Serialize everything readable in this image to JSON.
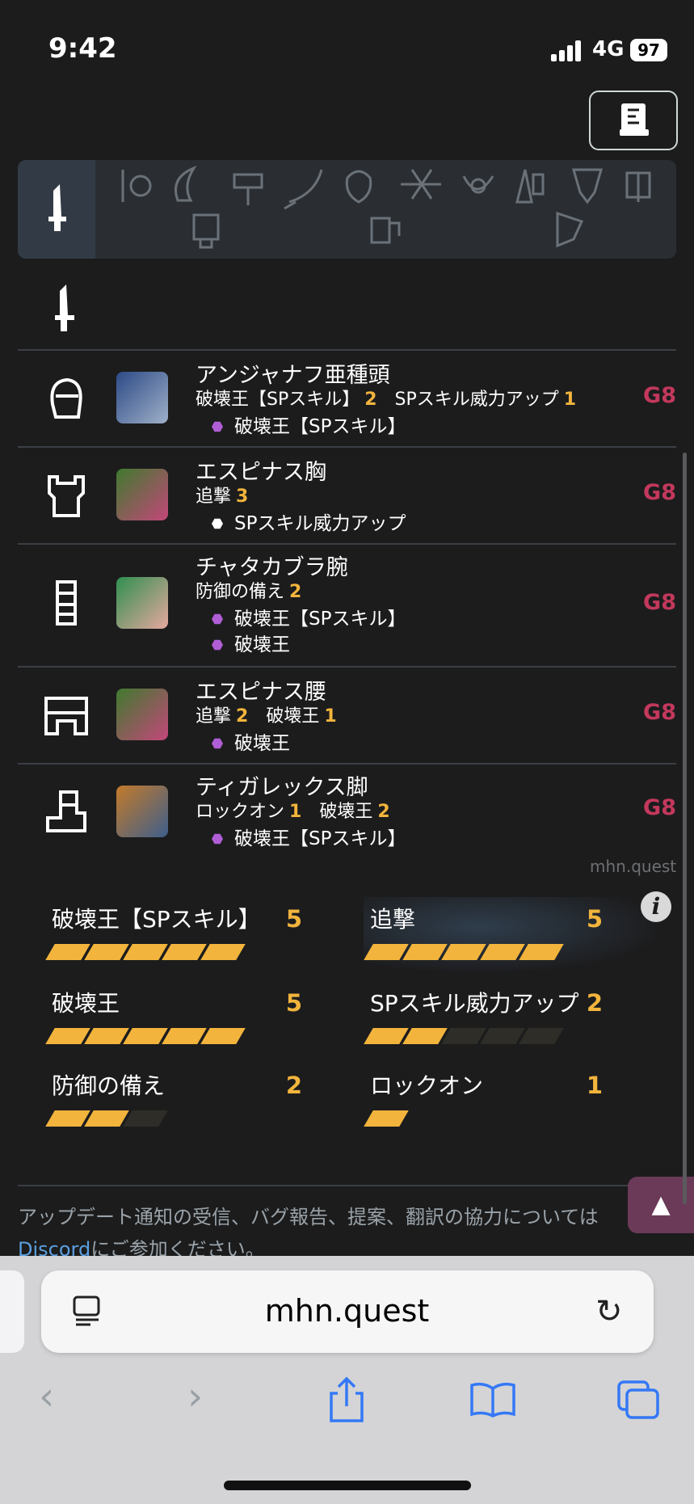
{
  "status": {
    "time": "9:42",
    "network": "4G",
    "battery": "97"
  },
  "current_weapon_icon": "great-sword-icon",
  "armor": [
    {
      "slot": "head",
      "icon": "helmet-icon",
      "name": "アンジャナフ亜種頭",
      "skills": [
        {
          "name": "破壊王【SPスキル】",
          "level": "2"
        },
        {
          "name": "SPスキル威力アップ",
          "level": "1"
        }
      ],
      "decos": [
        {
          "name": "破壊王【SPスキル】",
          "color": "#b05ed6"
        }
      ],
      "grade": "G8"
    },
    {
      "slot": "chest",
      "icon": "chest-icon",
      "name": "エスピナス胸",
      "skills": [
        {
          "name": "追撃",
          "level": "3"
        }
      ],
      "decos": [
        {
          "name": "SPスキル威力アップ",
          "color": "#ffffff"
        }
      ],
      "grade": "G8"
    },
    {
      "slot": "arms",
      "icon": "arms-icon",
      "name": "チャタカブラ腕",
      "skills": [
        {
          "name": "防御の備え",
          "level": "2"
        }
      ],
      "decos": [
        {
          "name": "破壊王【SPスキル】",
          "color": "#b05ed6"
        },
        {
          "name": "破壊王",
          "color": "#b05ed6"
        }
      ],
      "grade": "G8"
    },
    {
      "slot": "waist",
      "icon": "waist-icon",
      "name": "エスピナス腰",
      "skills": [
        {
          "name": "追撃",
          "level": "2"
        },
        {
          "name": "破壊王",
          "level": "1"
        }
      ],
      "decos": [
        {
          "name": "破壊王",
          "color": "#b05ed6"
        }
      ],
      "grade": "G8"
    },
    {
      "slot": "legs",
      "icon": "legs-icon",
      "name": "ティガレックス脚",
      "skills": [
        {
          "name": "ロックオン",
          "level": "1"
        },
        {
          "name": "破壊王",
          "level": "2"
        }
      ],
      "decos": [
        {
          "name": "破壊王【SPスキル】",
          "color": "#b05ed6"
        }
      ],
      "grade": "G8"
    }
  ],
  "watermark": "mhn.quest",
  "skill_summary": [
    {
      "name": "破壊王【SPスキル】",
      "level": "5",
      "filled": 5,
      "max": 5
    },
    {
      "name": "追撃",
      "level": "5",
      "filled": 5,
      "max": 5
    },
    {
      "name": "破壊王",
      "level": "5",
      "filled": 5,
      "max": 5
    },
    {
      "name": "SPスキル威力アップ",
      "level": "2",
      "filled": 2,
      "max": 5
    },
    {
      "name": "防御の備え",
      "level": "2",
      "filled": 2,
      "max": 3
    },
    {
      "name": "ロックオン",
      "level": "1",
      "filled": 1,
      "max": 1
    }
  ],
  "footer": {
    "text1": "アップデート通知の受信、バグ報告、提案、翻訳の協力については",
    "link": "Discord",
    "text2": "にご参加ください。"
  },
  "browser": {
    "url": "mhn.quest"
  },
  "colors": {
    "accent": "#f2b43c",
    "grade": "#c3385c",
    "background": "#1c1c1d"
  }
}
